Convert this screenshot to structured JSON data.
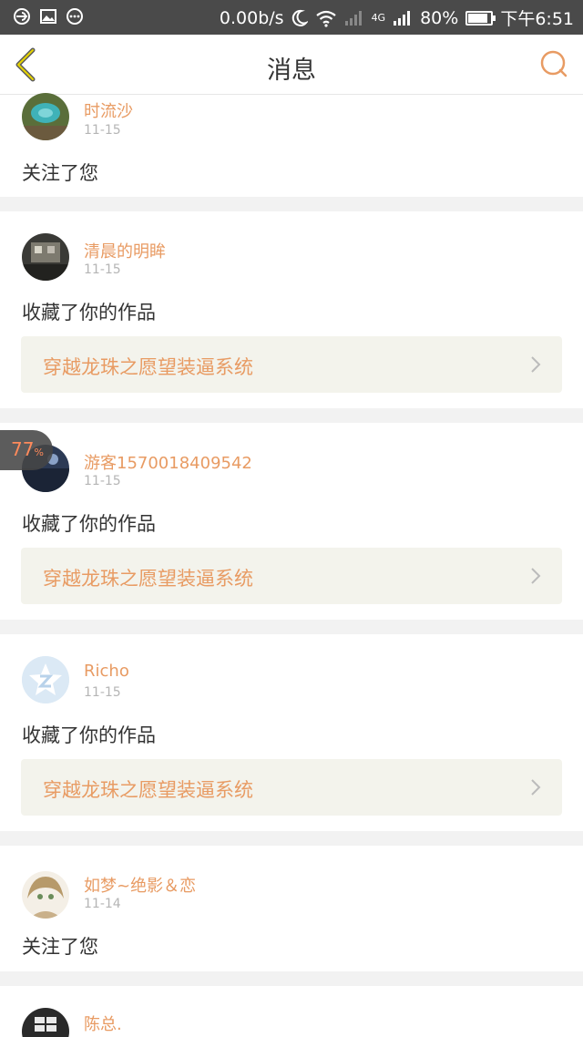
{
  "status_bar": {
    "speed": "0.00b/s",
    "network": "4G",
    "battery": "80%",
    "battery_level": 0.8,
    "time": "下午6:51"
  },
  "header": {
    "title": "消息"
  },
  "float_badge": {
    "value": "77",
    "unit": "%"
  },
  "accent_color": "#e89b63",
  "messages": [
    {
      "user": "时流沙",
      "date": "11-15",
      "action": "关注了您"
    },
    {
      "user": "清晨的明眸",
      "date": "11-15",
      "action": "收藏了你的作品",
      "work": "穿越龙珠之愿望装逼系统"
    },
    {
      "user": "游客1570018409542",
      "date": "11-15",
      "action": "收藏了你的作品",
      "work": "穿越龙珠之愿望装逼系统"
    },
    {
      "user": "Richo",
      "date": "11-15",
      "action": "收藏了你的作品",
      "work": "穿越龙珠之愿望装逼系统"
    },
    {
      "user": "如梦~绝影＆恋",
      "date": "11-14",
      "action": "关注了您"
    },
    {
      "user": "陈总.",
      "date": "",
      "action": ""
    }
  ]
}
